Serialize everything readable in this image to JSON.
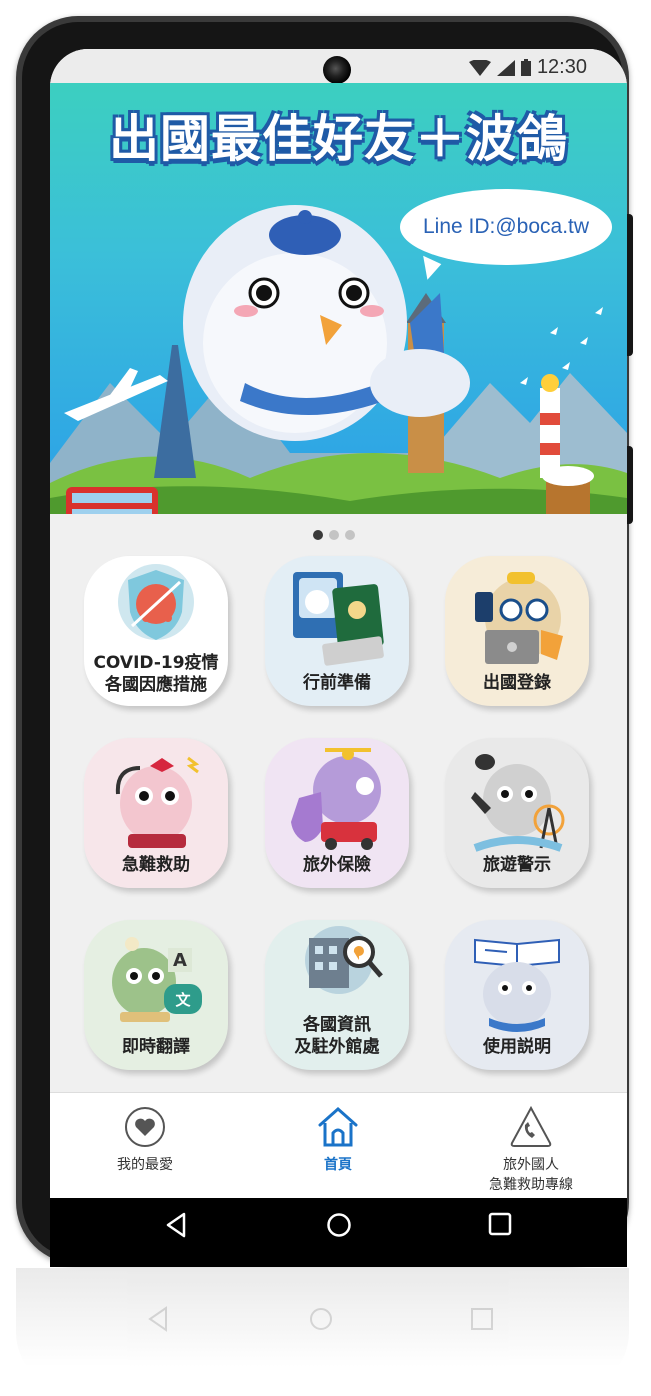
{
  "status_bar": {
    "time": "12:30"
  },
  "banner": {
    "title": "出國最佳好友＋波鴿",
    "line_id": "Line ID:@boca.tw",
    "slide_count": 3,
    "active_slide": 1
  },
  "tiles": [
    {
      "label": "COVID-19疫情\n各國因應措施",
      "bg": "#ffffff"
    },
    {
      "label": "行前準備",
      "bg": "#e3eef5"
    },
    {
      "label": "出國登錄",
      "bg": "#f6ecd8"
    },
    {
      "label": "急難救助",
      "bg": "#f7e6ea"
    },
    {
      "label": "旅外保險",
      "bg": "#f0e4f3"
    },
    {
      "label": "旅遊警示",
      "bg": "#e9e9e9"
    },
    {
      "label": "即時翻譯",
      "bg": "#e5efe2"
    },
    {
      "label": "各國資訊\n及駐外館處",
      "bg": "#e2efed"
    },
    {
      "label": "使用説明",
      "bg": "#e6eaf1"
    }
  ],
  "bottom_nav": {
    "favorites": "我的最愛",
    "home": "首頁",
    "hotline": "旅外國人\n急難救助專線"
  },
  "colors": {
    "accent": "#1a73c8",
    "banner_top": "#3ccfc0",
    "banner_bottom": "#2b9fe8"
  }
}
